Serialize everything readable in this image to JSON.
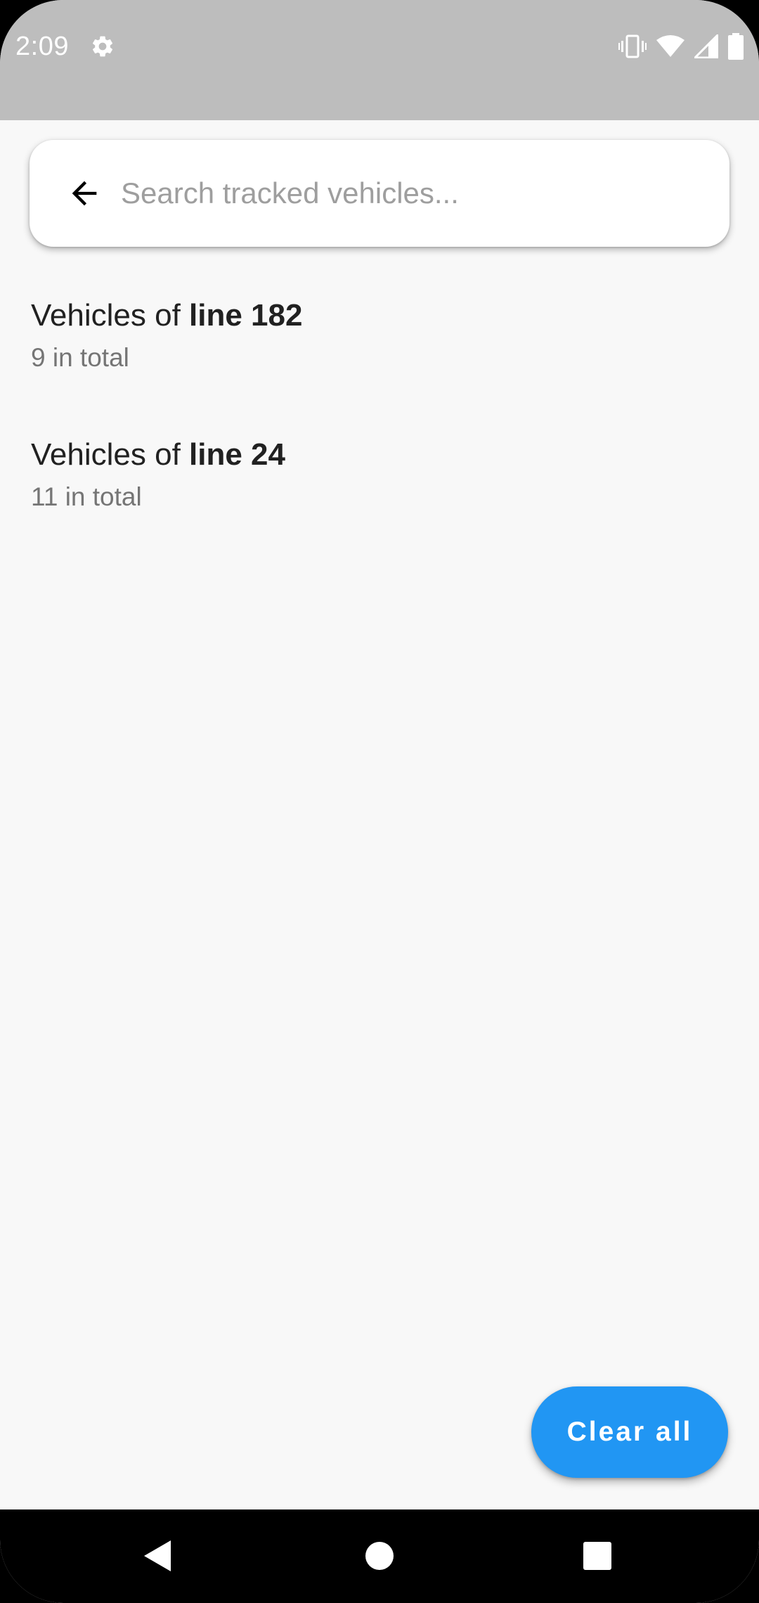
{
  "status_bar": {
    "time": "2:09",
    "icons": [
      "settings-icon",
      "vibrate-icon",
      "wifi-icon",
      "signal-icon",
      "battery-icon"
    ]
  },
  "search": {
    "placeholder": "Search tracked vehicles...",
    "value": "",
    "back_icon": "arrow-back-icon"
  },
  "tracked_lines": [
    {
      "prefix": "Vehicles of ",
      "line": "line 182",
      "count_text": "9 in total"
    },
    {
      "prefix": "Vehicles of ",
      "line": "line 24",
      "count_text": "11 in total"
    }
  ],
  "fab": {
    "label": "Clear all"
  },
  "nav_bar": {
    "icons": [
      "back-triangle-icon",
      "home-circle-icon",
      "recents-square-icon"
    ]
  },
  "colors": {
    "accent": "#2196f3",
    "status_bar": "#bdbdbd",
    "background": "#f8f8f8"
  }
}
